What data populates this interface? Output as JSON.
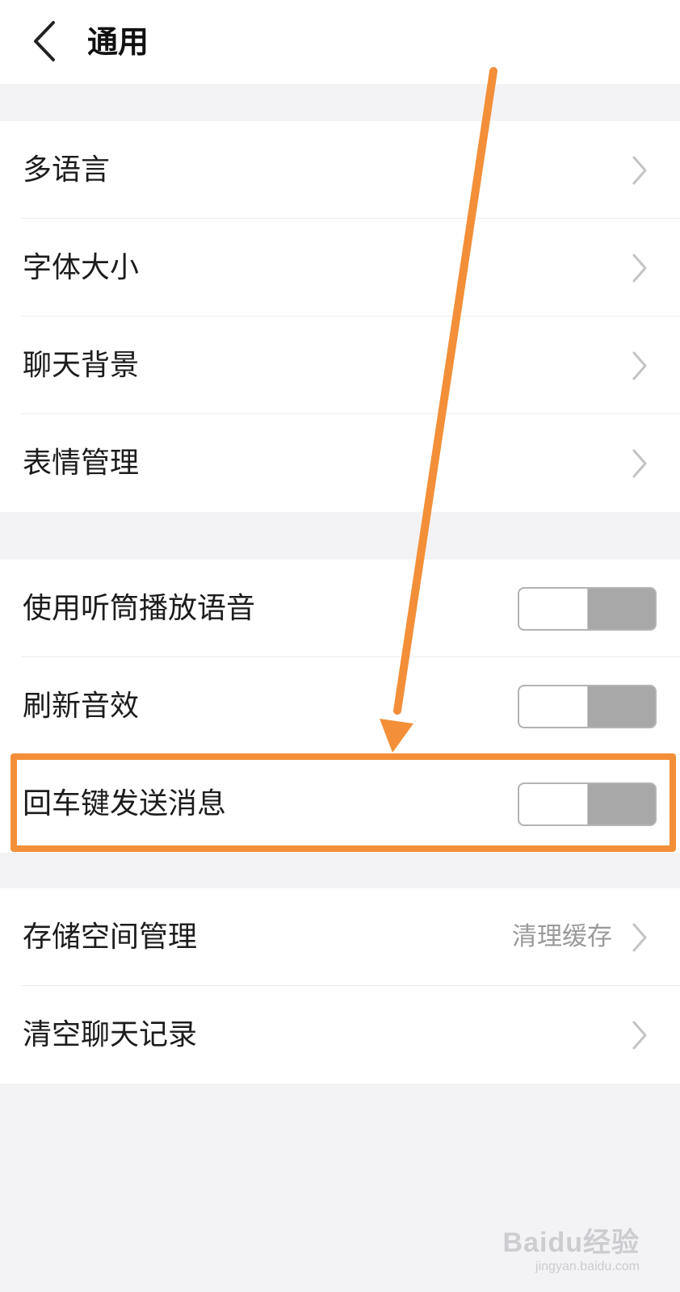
{
  "header": {
    "title": "通用",
    "back_icon": "chevron-left-icon"
  },
  "group1": {
    "items": [
      {
        "label": "多语言"
      },
      {
        "label": "字体大小"
      },
      {
        "label": "聊天背景"
      },
      {
        "label": "表情管理"
      }
    ]
  },
  "group2": {
    "items": [
      {
        "label": "使用听筒播放语音",
        "toggle_on": false
      },
      {
        "label": "刷新音效",
        "toggle_on": false
      },
      {
        "label": "回车键发送消息",
        "toggle_on": false
      }
    ]
  },
  "group3": {
    "items": [
      {
        "label": "存储空间管理",
        "value": "清理缓存"
      },
      {
        "label": "清空聊天记录"
      }
    ]
  },
  "annotation": {
    "color": "#f38f38"
  },
  "watermark": {
    "logo": "Baidu经验",
    "url": "jingyan.baidu.com"
  }
}
